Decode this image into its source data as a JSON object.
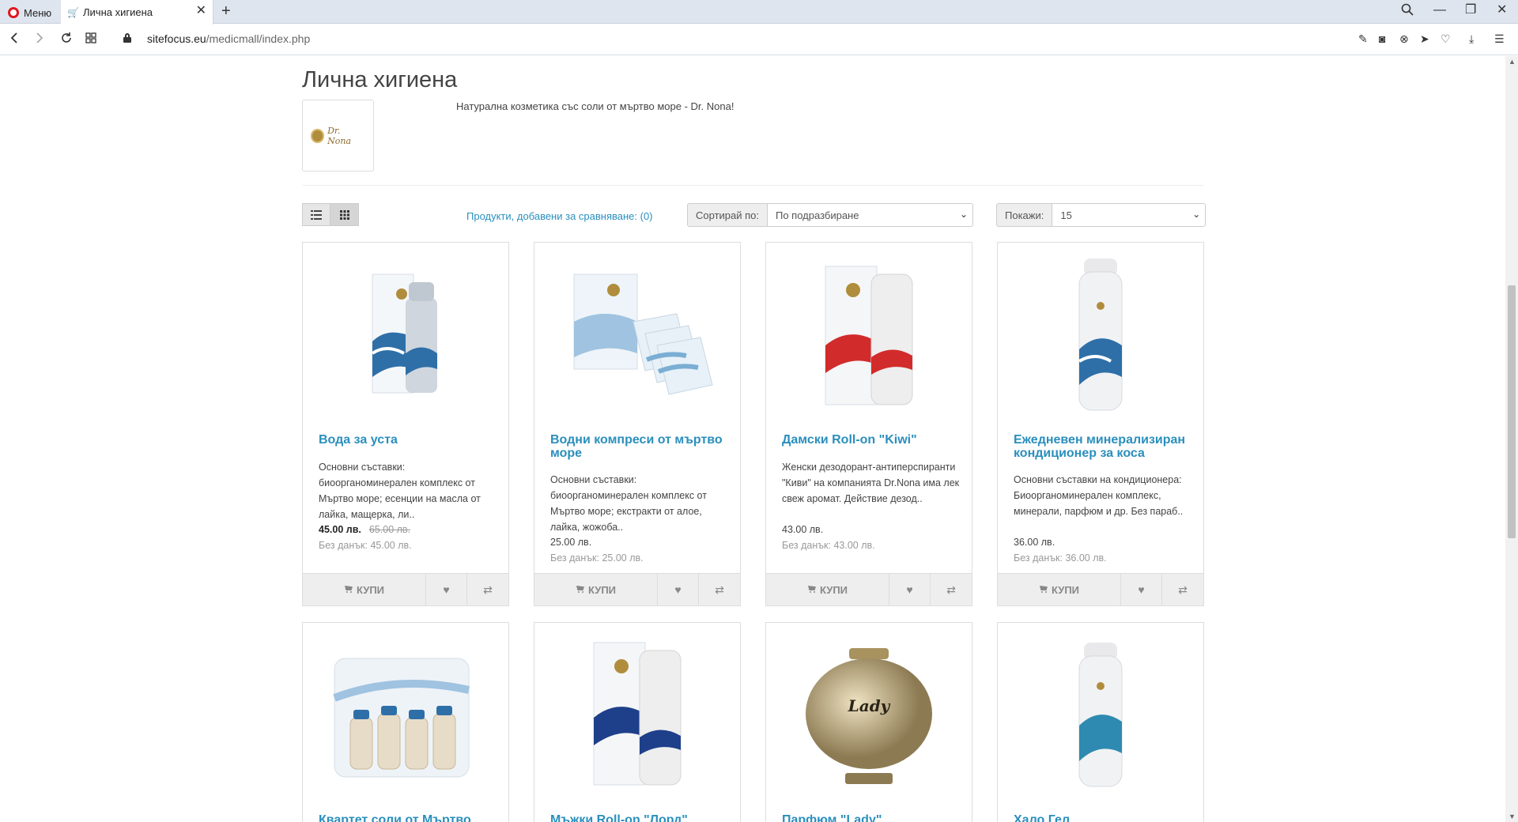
{
  "browser": {
    "menu_label": "Меню",
    "tab_title": "Лична хигиена",
    "url_host": "sitefocus.eu",
    "url_path": "/medicmall/index.php"
  },
  "page": {
    "title": "Лична хигиена",
    "category_description": "Натурална козметика със соли от мъртво море - Dr. Nona!",
    "category_logo_text": "Dr. Nona",
    "compare_link": "Продукти, добавени за сравняване: (0)",
    "sort_label": "Сортирай по:",
    "sort_value": "По подразбиране",
    "limit_label": "Покажи:",
    "limit_value": "15"
  },
  "buy_label": "КУПИ",
  "products": [
    {
      "name": "Вода за уста",
      "desc": "Основни съставки: биоорганоминерален комплекс от Мъртво море; есенции на масла от лайка, мащерка, ли..",
      "price": "45.00 лв.",
      "old_price": "65.00 лв.",
      "tax": "Без данък: 45.00 лв.",
      "image": "mouthwash-bottle-image"
    },
    {
      "name": "Водни компреси от мъртво море",
      "desc": "Основни съставки: биоорганоминерален комплекс от Мъртво море; екстракти от алое, лайка, жожоба..",
      "price": "25.00 лв.",
      "tax": "Без данък: 25.00 лв.",
      "image": "compress-packs-image"
    },
    {
      "name": "Дамски Roll-on \"Kiwi\"",
      "desc": "Женски дезодорант-антиперспиранти \"Киви\" на компанията Dr.Nona има лек свеж аромат. Действие дезод..",
      "price": "43.00 лв.",
      "tax": "Без данък: 43.00 лв.",
      "image": "rollon-kiwi-image"
    },
    {
      "name": "Ежедневен минерализиран кондиционер за коса",
      "desc": "Основни съставки на кондиционера: Биоорганоминерален комплекс, минерали, парфюм и др. Без параб..",
      "price": "36.00 лв.",
      "tax": "Без данък: 36.00 лв.",
      "image": "conditioner-bottle-image"
    },
    {
      "name": "Квартет соли от Мъртво море",
      "image": "salt-quartet-image"
    },
    {
      "name": "Мъжки Roll-on \"Лорд\"",
      "image": "rollon-lord-image"
    },
    {
      "name": "Парфюм \"Lady\"",
      "image": "perfume-lady-image"
    },
    {
      "name": "Хало Гел",
      "image": "halo-gel-image"
    }
  ],
  "colors": {
    "link": "#2a8fbd",
    "accent_sea": "#2e6fa8",
    "accent_red": "#d22b2b",
    "gold": "#b08d3c"
  }
}
